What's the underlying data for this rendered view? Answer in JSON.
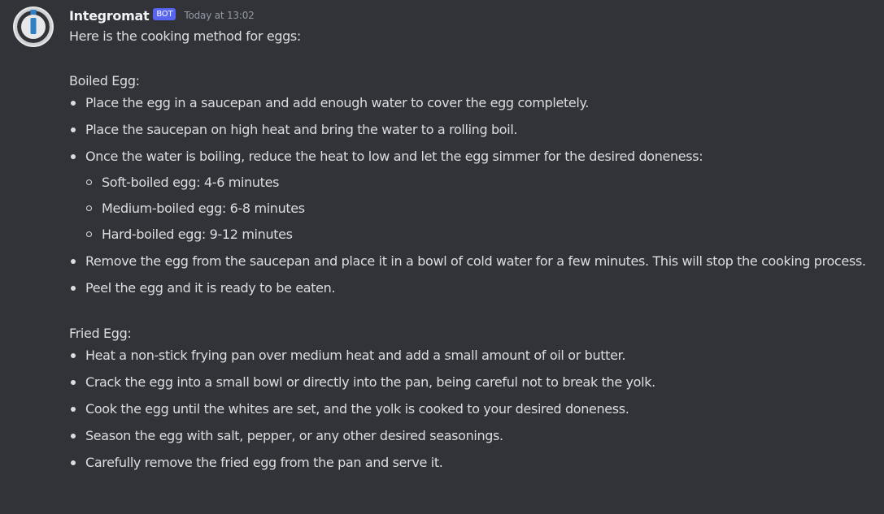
{
  "author": {
    "name": "Integromat",
    "tag": "BOT",
    "timestamp": "Today at 13:02",
    "avatar_icon": "integromat-logo-icon"
  },
  "message": {
    "intro": "Here is the cooking method for eggs:",
    "sections": [
      {
        "title": "Boiled Egg:",
        "items": [
          "Place the egg in a saucepan and add enough water to cover the egg completely.",
          "Place the saucepan on high heat and bring the water to a rolling boil.",
          "Once the water is boiling, reduce the heat to low and let the egg simmer for the desired doneness:",
          "Remove the egg from the saucepan and place it in a bowl of cold water for a few minutes. This will stop the cooking process.",
          "Peel the egg and it is ready to be eaten."
        ],
        "subitems": [
          "Soft-boiled egg: 4-6 minutes",
          "Medium-boiled egg: 6-8 minutes",
          "Hard-boiled egg: 9-12 minutes"
        ]
      },
      {
        "title": "Fried Egg:",
        "items": [
          "Heat a non-stick frying pan over medium heat and add a small amount of oil or butter.",
          "Crack the egg into a small bowl or directly into the pan, being careful not to break the yolk.",
          "Cook the egg until the whites are set, and the yolk is cooked to your desired doneness.",
          "Season the egg with salt, pepper, or any other desired seasonings.",
          "Carefully remove the fried egg from the pan and serve it."
        ]
      }
    ]
  },
  "colors": {
    "background": "#313338",
    "text": "#dbdee1",
    "username": "#f2f3f5",
    "bot_tag": "#5865f2",
    "timestamp": "#949ba4",
    "avatar_ring": "#cfd0d2",
    "avatar_accent": "#2f80c5"
  }
}
